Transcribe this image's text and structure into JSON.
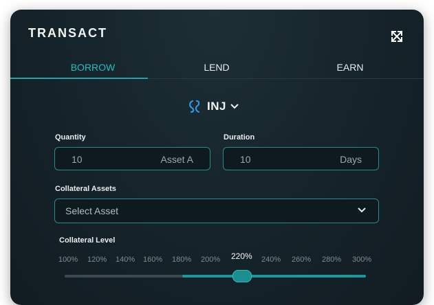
{
  "panel": {
    "title": "TRANSACT"
  },
  "tabs": [
    {
      "label": "BORROW",
      "active": true
    },
    {
      "label": "LEND",
      "active": false
    },
    {
      "label": "EARN",
      "active": false
    }
  ],
  "asset": {
    "symbol": "INJ",
    "icon": "injective-logo-icon"
  },
  "quantity": {
    "label": "Quantity",
    "value": "10",
    "unit": "Asset A"
  },
  "duration": {
    "label": "Duration",
    "value": "10",
    "unit": "Days"
  },
  "collateral_assets": {
    "label": "Collateral Assets",
    "placeholder": "Select Asset"
  },
  "collateral_level": {
    "label": "Collateral Level",
    "options": [
      "100%",
      "120%",
      "140%",
      "160%",
      "180%",
      "200%",
      "220%",
      "240%",
      "260%",
      "280%",
      "300%"
    ],
    "selected": "220%",
    "selected_index": 6
  },
  "colors": {
    "accent": "#25bfc1",
    "panel_bg": "#15232a",
    "field_border": "#2b8a8a"
  }
}
